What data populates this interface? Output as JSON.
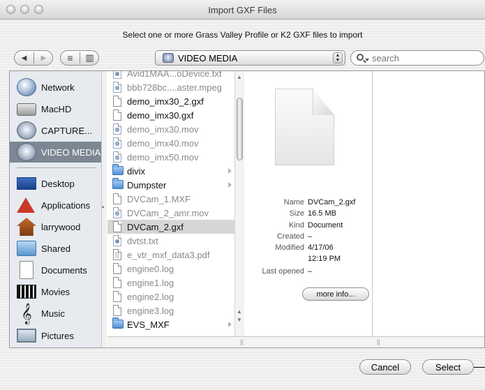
{
  "window": {
    "title": "Import GXF Files"
  },
  "prompt": "Select one or more Grass Valley Profile or K2 GXF files to import",
  "toolbar": {
    "back": "◀",
    "forward": "▶",
    "list_view": "≡",
    "column_view": "▥",
    "location": "VIDEO MEDIA",
    "search_placeholder": "search"
  },
  "sidebar": {
    "devices": [
      {
        "label": "Network",
        "icon": "network-globe-icon"
      },
      {
        "label": "MacHD",
        "icon": "hard-drive-icon"
      },
      {
        "label": "CAPTURE...",
        "icon": "disk-icon"
      },
      {
        "label": "VIDEO MEDIA",
        "icon": "disk-icon",
        "selected": true
      }
    ],
    "places": [
      {
        "label": "Desktop",
        "icon": "desktop-icon"
      },
      {
        "label": "Applications",
        "icon": "applications-icon"
      },
      {
        "label": "larrywood",
        "icon": "home-icon"
      },
      {
        "label": "Shared",
        "icon": "shared-folder-icon"
      },
      {
        "label": "Documents",
        "icon": "documents-icon"
      },
      {
        "label": "Movies",
        "icon": "movies-icon"
      },
      {
        "label": "Music",
        "icon": "music-icon"
      },
      {
        "label": "Pictures",
        "icon": "pictures-icon"
      }
    ]
  },
  "files": [
    {
      "name": "Avid1MAA...oDevice.txt",
      "type": "doc",
      "enabled": false
    },
    {
      "name": "bbb728bc....aster.mpeg",
      "type": "qt",
      "enabled": false
    },
    {
      "name": "demo_imx30_2.gxf",
      "type": "file",
      "enabled": true
    },
    {
      "name": "demo_imx30.gxf",
      "type": "file",
      "enabled": true
    },
    {
      "name": "demo_imx30.mov",
      "type": "qt",
      "enabled": false
    },
    {
      "name": "demo_imx40.mov",
      "type": "qt",
      "enabled": false
    },
    {
      "name": "demo_imx50.mov",
      "type": "qt",
      "enabled": false
    },
    {
      "name": "divix",
      "type": "folder",
      "enabled": true
    },
    {
      "name": "Dumpster",
      "type": "folder",
      "enabled": true
    },
    {
      "name": "DVCam_1.MXF",
      "type": "file",
      "enabled": false
    },
    {
      "name": "DVCam_2_amr.mov",
      "type": "qt",
      "enabled": false
    },
    {
      "name": "DVCam_2.gxf",
      "type": "file",
      "enabled": true,
      "selected": true
    },
    {
      "name": "dvtst.txt",
      "type": "doc",
      "enabled": false
    },
    {
      "name": "e_vtr_mxf_data3.pdf",
      "type": "pdf",
      "enabled": false
    },
    {
      "name": "engine0.log",
      "type": "file",
      "enabled": false
    },
    {
      "name": "engine1.log",
      "type": "file",
      "enabled": false
    },
    {
      "name": "engine2.log",
      "type": "file",
      "enabled": false
    },
    {
      "name": "engine3.log",
      "type": "file",
      "enabled": false
    },
    {
      "name": "EVS_MXF",
      "type": "folder",
      "enabled": true
    }
  ],
  "preview": {
    "name_label": "Name",
    "name": "DVCam_2.gxf",
    "size_label": "Size",
    "size": "16.5 MB",
    "kind_label": "Kind",
    "kind": "Document",
    "created_label": "Created",
    "created": "–",
    "modified_label": "Modified",
    "modified_date": "4/17/06",
    "modified_time": "12:19 PM",
    "last_opened_label": "Last opened",
    "last_opened": "–",
    "more_info": "more info..."
  },
  "buttons": {
    "cancel": "Cancel",
    "select": "Select"
  }
}
